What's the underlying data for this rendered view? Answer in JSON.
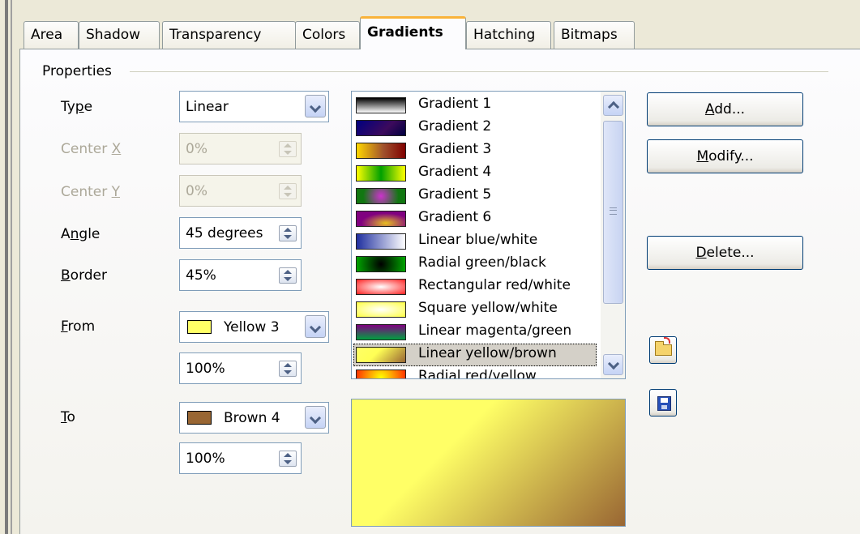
{
  "tabs": [
    {
      "label": "Area",
      "active": false
    },
    {
      "label": "Shadow",
      "active": false
    },
    {
      "label": "Transparency",
      "active": false
    },
    {
      "label": "Colors",
      "active": false
    },
    {
      "label": "Gradients",
      "active": true
    },
    {
      "label": "Hatching",
      "active": false
    },
    {
      "label": "Bitmaps",
      "active": false
    }
  ],
  "properties": {
    "group_label": "Properties",
    "type": {
      "label_pre": "Ty",
      "label_mn": "p",
      "label_post": "e",
      "value": "Linear"
    },
    "center_x": {
      "label_pre": "Center ",
      "label_mn": "X",
      "value": "0%",
      "enabled": false
    },
    "center_y": {
      "label_pre": "Center ",
      "label_mn": "Y",
      "value": "0%",
      "enabled": false
    },
    "angle": {
      "label_pre": "A",
      "label_mn": "n",
      "label_post": "gle",
      "value": "45 degrees"
    },
    "border": {
      "label_mn": "B",
      "label_post": "order",
      "value": "45%"
    },
    "from": {
      "label_mn": "F",
      "label_post": "rom",
      "color_name": "Yellow 3",
      "color": "#ffff66",
      "intensity": "100%"
    },
    "to": {
      "label_mn": "T",
      "label_post": "o",
      "color_name": "Brown 4",
      "color": "#996633",
      "intensity": "100%"
    }
  },
  "gradient_list": {
    "selected_index": 11,
    "items": [
      {
        "name": "Gradient 1",
        "preview": "linear-gradient(180deg,#000 0%,#fff 100%)"
      },
      {
        "name": "Gradient 2",
        "preview": "linear-gradient(135deg,#000080 0%,#3c0a5c 60%,#000040 100%)"
      },
      {
        "name": "Gradient 3",
        "preview": "linear-gradient(90deg,#ffd700 0%,#a0522d 55%,#800000 100%)"
      },
      {
        "name": "Gradient 4",
        "preview": "linear-gradient(90deg,#ffff00 0%,#00a000 50%,#ffff00 100%)"
      },
      {
        "name": "Gradient 5",
        "preview": "radial-gradient(circle,#cc33cc 0%,#117711 70%)"
      },
      {
        "name": "Gradient 6",
        "preview": "radial-gradient(ellipse at 60% 80%,#e8c020 0%,#800080 60%)"
      },
      {
        "name": "Linear blue/white",
        "preview": "linear-gradient(90deg,#2030a0 0%,#ffffff 100%)"
      },
      {
        "name": "Radial green/black",
        "preview": "radial-gradient(circle,#000 0%,#00aa00 100%)"
      },
      {
        "name": "Rectangular red/white",
        "preview": "radial-gradient(ellipse,#ffffff 0%,#ff2020 100%)"
      },
      {
        "name": "Square yellow/white",
        "preview": "radial-gradient(ellipse,#ffffff 0%,#ffff40 100%)"
      },
      {
        "name": "Linear magenta/green",
        "preview": "linear-gradient(180deg,#800080 0%,#00a040 100%)"
      },
      {
        "name": "Linear yellow/brown",
        "preview": "linear-gradient(135deg,#ffff66 0%,#ffff55 40%,#996633 100%)"
      },
      {
        "name": "Radial red/yellow",
        "preview": "radial-gradient(circle,#ffff00 0%,#ff3000 100%)"
      }
    ]
  },
  "buttons": {
    "add": {
      "pre": "",
      "mn": "A",
      "post": "dd..."
    },
    "modify": {
      "pre": "",
      "mn": "M",
      "post": "odify..."
    },
    "delete": {
      "pre": "",
      "mn": "D",
      "post": "elete..."
    },
    "load_icon": "folder-open-icon",
    "save_icon": "floppy-disk-icon"
  },
  "preview": {
    "from_color": "#ffff66",
    "to_color": "#996633",
    "angle_degrees": 45,
    "border_percent": 45
  }
}
